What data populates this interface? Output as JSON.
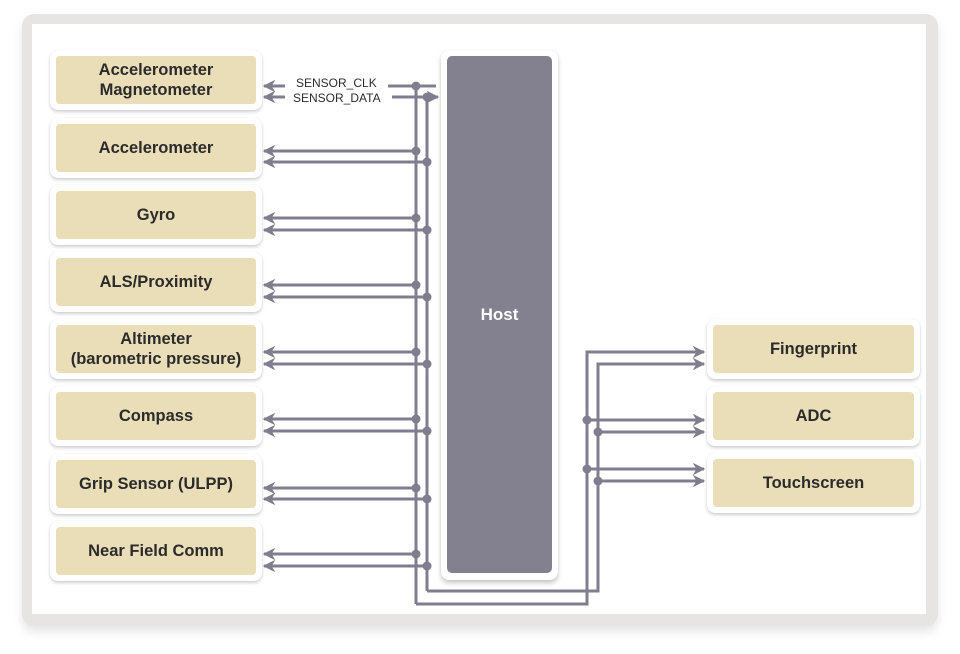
{
  "diagram": {
    "colors": {
      "frame": "#e6e5e4",
      "block_fill": "#e9deb8",
      "host_fill": "#83818f",
      "wire": "#807e8e",
      "text": "#2b2b2b",
      "host_text": "#ffffff"
    },
    "host": {
      "label": "Host"
    },
    "signals": {
      "clk": "SENSOR_CLK",
      "data": "SENSOR_DATA"
    },
    "left_devices": [
      {
        "id": "accel-mag",
        "line1": "Accelerometer",
        "line2": "Magnetometer"
      },
      {
        "id": "accelerometer",
        "line1": "Accelerometer",
        "line2": ""
      },
      {
        "id": "gyro",
        "line1": "Gyro",
        "line2": ""
      },
      {
        "id": "als-proximity",
        "line1": "ALS/Proximity",
        "line2": ""
      },
      {
        "id": "altimeter",
        "line1": "Altimeter",
        "line2": "(barometric pressure)"
      },
      {
        "id": "compass",
        "line1": "Compass",
        "line2": ""
      },
      {
        "id": "grip-sensor",
        "line1": "Grip Sensor (ULPP)",
        "line2": ""
      },
      {
        "id": "nfc",
        "line1": "Near Field Comm",
        "line2": ""
      }
    ],
    "right_devices": [
      {
        "id": "fingerprint",
        "label": "Fingerprint"
      },
      {
        "id": "adc",
        "label": "ADC"
      },
      {
        "id": "touchscreen",
        "label": "Touchscreen"
      }
    ],
    "connections": {
      "bus": [
        "SENSOR_CLK",
        "SENSOR_DATA"
      ],
      "from": "Host",
      "to_left": [
        "Accelerometer Magnetometer",
        "Accelerometer",
        "Gyro",
        "ALS/Proximity",
        "Altimeter (barometric pressure)",
        "Compass",
        "Grip Sensor (ULPP)",
        "Near Field Comm"
      ],
      "to_right": [
        "Fingerprint",
        "ADC",
        "Touchscreen"
      ]
    }
  }
}
